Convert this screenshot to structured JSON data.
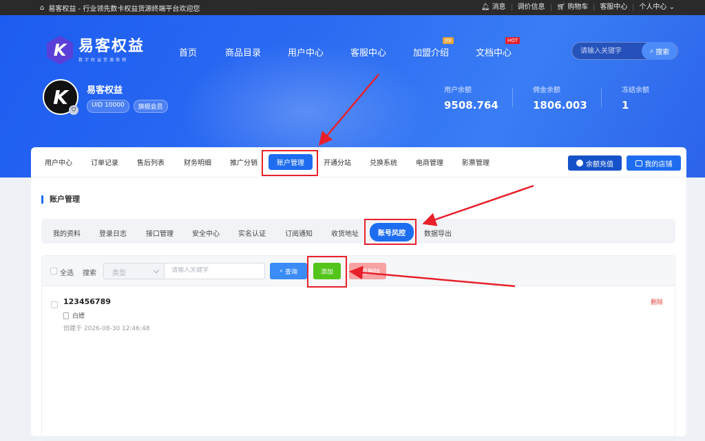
{
  "topbar": {
    "welcome": "易客权益 - 行业领先数卡权益货源终端平台欢迎您",
    "links": [
      "消息",
      "调价信息",
      "购物车",
      "客服中心",
      "个人中心"
    ]
  },
  "logo": {
    "mark": "K",
    "name": "易客权益",
    "slogan": "数字权益货源供销"
  },
  "nav": {
    "items": [
      "首页",
      "商品目录",
      "用户中心",
      "客服中心",
      "加盟介绍",
      "文档中心"
    ],
    "badge_join": "JOI",
    "badge_hot": "HOT"
  },
  "search": {
    "placeholder": "请输入关键字",
    "button": "搜索"
  },
  "profile": {
    "name": "易客权益",
    "uid": "UID 10000",
    "level": "旗舰会员"
  },
  "balances": [
    {
      "label": "用户余额",
      "value": "9508.764"
    },
    {
      "label": "佣金余额",
      "value": "1806.003"
    },
    {
      "label": "冻结余额",
      "value": "1"
    }
  ],
  "tabs": [
    "用户中心",
    "订单记录",
    "售后列表",
    "财务明细",
    "推广分销",
    "账户管理",
    "开通分站",
    "兑换系统",
    "电商管理",
    "影票管理"
  ],
  "actions": {
    "recharge": "余额充值",
    "shop": "我的店铺"
  },
  "section_title": "账户管理",
  "subtabs": [
    "我的资料",
    "登录日志",
    "接口管理",
    "安全中心",
    "实名认证",
    "订阅通知",
    "收货地址",
    "账号风控",
    "数据导出"
  ],
  "filter": {
    "select_all": "全选",
    "search_label": "搜索",
    "type_placeholder": "类型",
    "keyword_placeholder": "请输入关键字",
    "query": "查询",
    "add": "添加",
    "batch_delete": "批量删除"
  },
  "records": [
    {
      "name": "123456789",
      "type": "白嫖",
      "created": "创建于 2026-08-30 12:46:48",
      "delete": "删除"
    }
  ],
  "colors": {
    "primary": "#1e6df0",
    "add": "#52c41a",
    "danger": "#e8202a"
  }
}
